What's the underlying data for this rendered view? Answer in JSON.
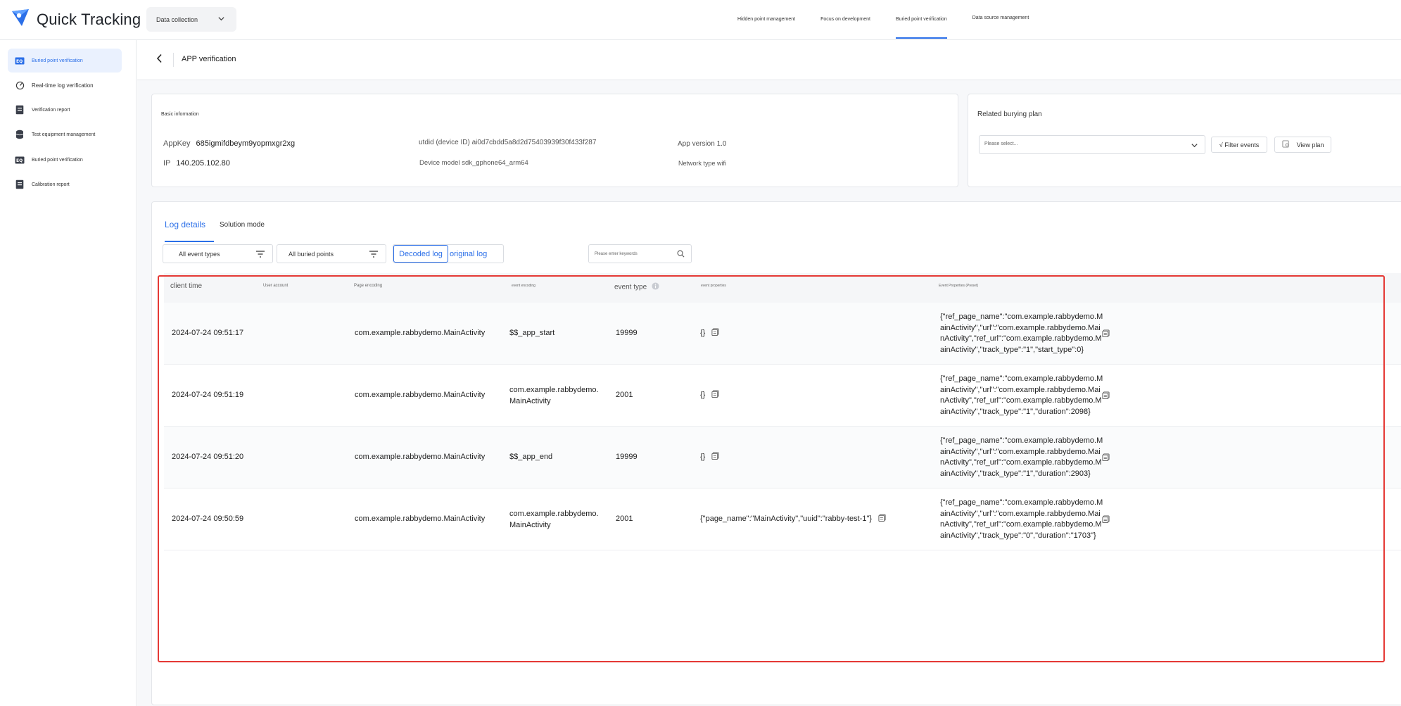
{
  "app": {
    "name": "Quick Tracking",
    "app_select": "Data collection"
  },
  "topnav": [
    {
      "label": "Hidden point management"
    },
    {
      "label": "Focus on development"
    },
    {
      "label": "Buried point verification"
    },
    {
      "label": "Data source management"
    }
  ],
  "sidebar": {
    "items": [
      {
        "label": "Buried point verification",
        "icon": "scan-icon"
      },
      {
        "label": "Real-time log verification",
        "icon": "gauge-icon"
      },
      {
        "label": "Verification report",
        "icon": "report-icon"
      },
      {
        "label": "Test equipment management",
        "icon": "database-icon"
      },
      {
        "label": "Buried point verification",
        "icon": "scan-icon"
      },
      {
        "label": "Calibration report",
        "icon": "report-icon"
      }
    ]
  },
  "page": {
    "title": "APP verification"
  },
  "basic": {
    "title": "Basic information",
    "appkey_label": "AppKey",
    "appkey_value": "685igmifdbeym9yopmxgr2xg",
    "ip_label": "IP",
    "ip_value": "140.205.102.80",
    "utdid": "utdid (device ID) ai0d7cbdd5a8d2d75403939f30f433f287",
    "device_model": "Device model sdk_gphone64_arm64",
    "app_version": "App version 1.0",
    "network": "Network type wifi"
  },
  "plan": {
    "title": "Related burying plan",
    "select_placeholder": "Please select...",
    "filter_button": "√ Filter events",
    "view_button": "View plan"
  },
  "log": {
    "tabs": [
      {
        "label": "Log details"
      },
      {
        "label": "Solution mode"
      }
    ],
    "filter_event_types": "All event types",
    "filter_buried_points": "All buried points",
    "mode_decoded": "Decoded log",
    "mode_original": "original log",
    "search_placeholder": "Please enter keywords",
    "columns": {
      "client_time": "client time",
      "user_account": "User account",
      "page_encoding": "Page encoding",
      "event_encoding": "event encoding",
      "event_type": "event type",
      "event_properties": "event properties",
      "event_properties_preset": "Event Properties (Preset)"
    },
    "rows": [
      {
        "client_time": "2024-07-24 09:51:17",
        "page_encoding": "com.example.rabbydemo.MainActivity",
        "event_encoding": "$$_app_start",
        "event_type": "19999",
        "event_properties": "{}",
        "preset": "{\"ref_page_name\":\"com.example.rabbydemo.MainActivity\",\"url\":\"com.example.rabbydemo.MainActivity\",\"ref_url\":\"com.example.rabbydemo.MainActivity\",\"track_type\":\"1\",\"start_type\":0}"
      },
      {
        "client_time": "2024-07-24 09:51:19",
        "page_encoding": "com.example.rabbydemo.MainActivity",
        "event_encoding": "com.example.rabbydemo.MainActivity",
        "event_type": "2001",
        "event_properties": "{}",
        "preset": "{\"ref_page_name\":\"com.example.rabbydemo.MainActivity\",\"url\":\"com.example.rabbydemo.MainActivity\",\"ref_url\":\"com.example.rabbydemo.MainActivity\",\"track_type\":\"1\",\"duration\":2098}"
      },
      {
        "client_time": "2024-07-24 09:51:20",
        "page_encoding": "com.example.rabbydemo.MainActivity",
        "event_encoding": "$$_app_end",
        "event_type": "19999",
        "event_properties": "{}",
        "preset": "{\"ref_page_name\":\"com.example.rabbydemo.MainActivity\",\"url\":\"com.example.rabbydemo.MainActivity\",\"ref_url\":\"com.example.rabbydemo.MainActivity\",\"track_type\":\"1\",\"duration\":2903}"
      },
      {
        "client_time": "2024-07-24 09:50:59",
        "page_encoding": "com.example.rabbydemo.MainActivity",
        "event_encoding": "com.example.rabbydemo.MainActivity",
        "event_type": "2001",
        "event_properties": "{\"page_name\":\"MainActivity\",\"uuid\":\"rabby-test-1\"}",
        "preset": "{\"ref_page_name\":\"com.example.rabbydemo.MainActivity\",\"url\":\"com.example.rabbydemo.MainActivity\",\"ref_url\":\"com.example.rabbydemo.MainActivity\",\"track_type\":\"0\",\"duration\":\"1703\"}"
      }
    ]
  },
  "colors": {
    "accent": "#2b6fe8",
    "highlight_box": "#e53935"
  }
}
